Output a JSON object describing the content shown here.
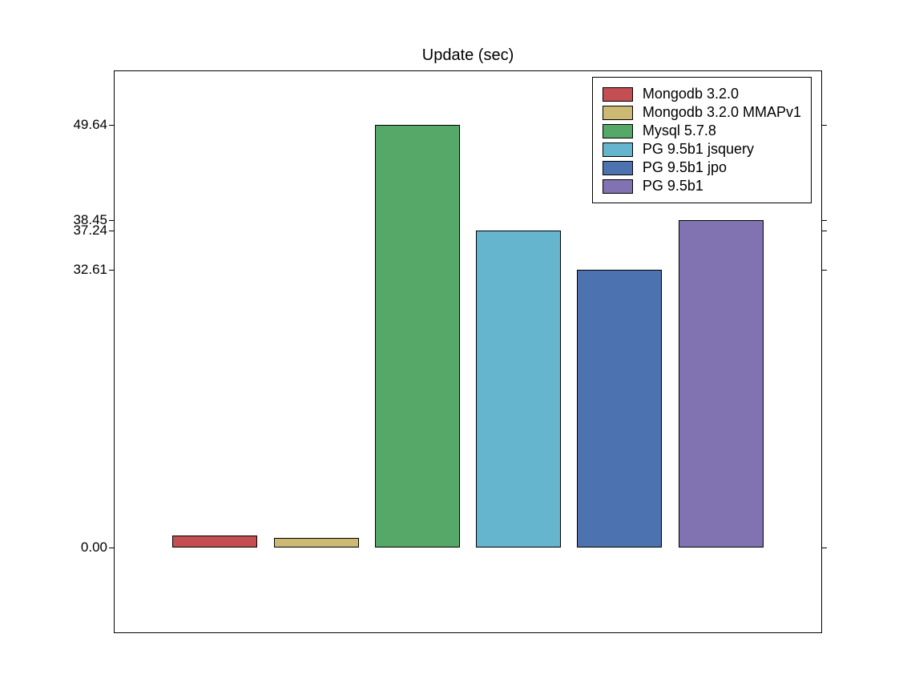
{
  "chart_data": {
    "type": "bar",
    "title": "Update (sec)",
    "categories": [
      "Mongodb 3.2.0",
      "Mongodb 3.2.0 MMAPv1",
      "Mysql 5.7.8",
      "PG 9.5b1 jsquery",
      "PG 9.5b1 jpo",
      "PG 9.5b1"
    ],
    "values": [
      1.5,
      1.2,
      49.64,
      37.24,
      32.61,
      38.45
    ],
    "colors": [
      "#c44e52",
      "#ccb974",
      "#55a868",
      "#64b5cd",
      "#4c72b0",
      "#8172b2"
    ],
    "ytick_labels": [
      "0.00",
      "32.61",
      "37.24",
      "38.45",
      "49.64"
    ],
    "ytick_values": [
      0.0,
      32.61,
      37.24,
      38.45,
      49.64
    ],
    "ylim_min": -10,
    "ylim_max": 56
  },
  "legend": {
    "items": [
      {
        "label": "Mongodb 3.2.0",
        "color": "#c44e52"
      },
      {
        "label": "Mongodb 3.2.0 MMAPv1",
        "color": "#ccb974"
      },
      {
        "label": "Mysql 5.7.8",
        "color": "#55a868"
      },
      {
        "label": "PG 9.5b1 jsquery",
        "color": "#64b5cd"
      },
      {
        "label": "PG 9.5b1 jpo",
        "color": "#4c72b0"
      },
      {
        "label": "PG 9.5b1",
        "color": "#8172b2"
      }
    ]
  }
}
